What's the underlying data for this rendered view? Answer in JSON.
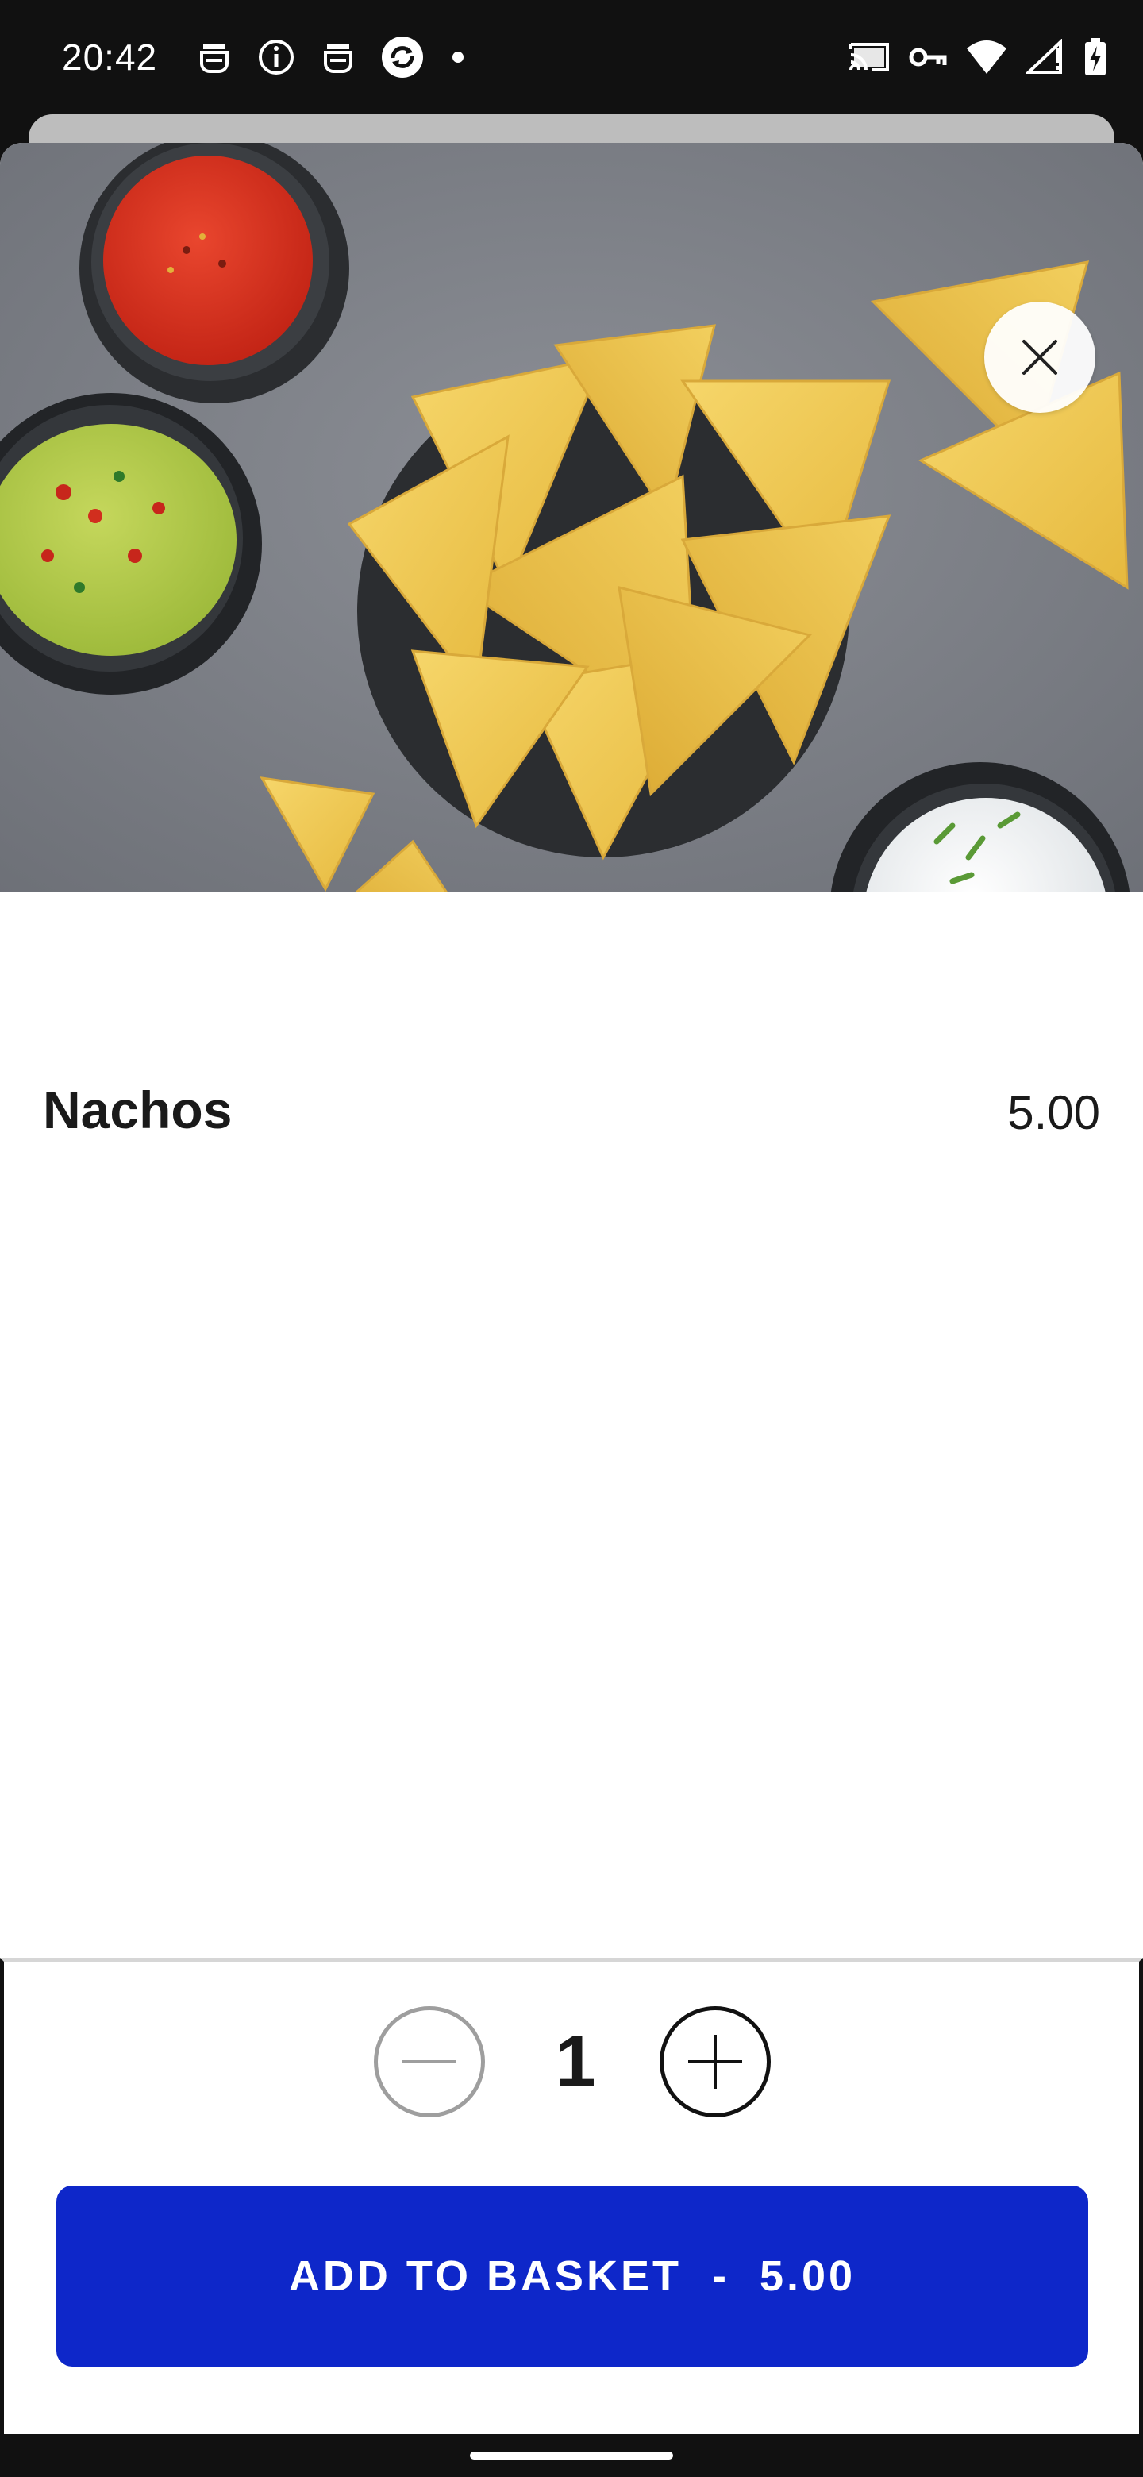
{
  "status_bar": {
    "time": "20:42",
    "left_icons": [
      "robot-icon",
      "info-icon",
      "robot-icon",
      "sync-icon",
      "dot-icon"
    ],
    "right_icons": [
      "cast-icon",
      "vpn-key-icon",
      "wifi-icon",
      "signal-icon",
      "battery-charging-icon"
    ]
  },
  "product": {
    "image_icon": "nachos-photo",
    "name": "Nachos",
    "price": "5.00"
  },
  "quantity": {
    "value": "1",
    "decrement_icon": "minus-icon",
    "increment_icon": "plus-icon"
  },
  "cart": {
    "add_label": "ADD TO BASKET  -  5.00"
  },
  "colors": {
    "accent": "#0e27c9",
    "status_bar": "#111111",
    "sheet": "#ffffff"
  }
}
